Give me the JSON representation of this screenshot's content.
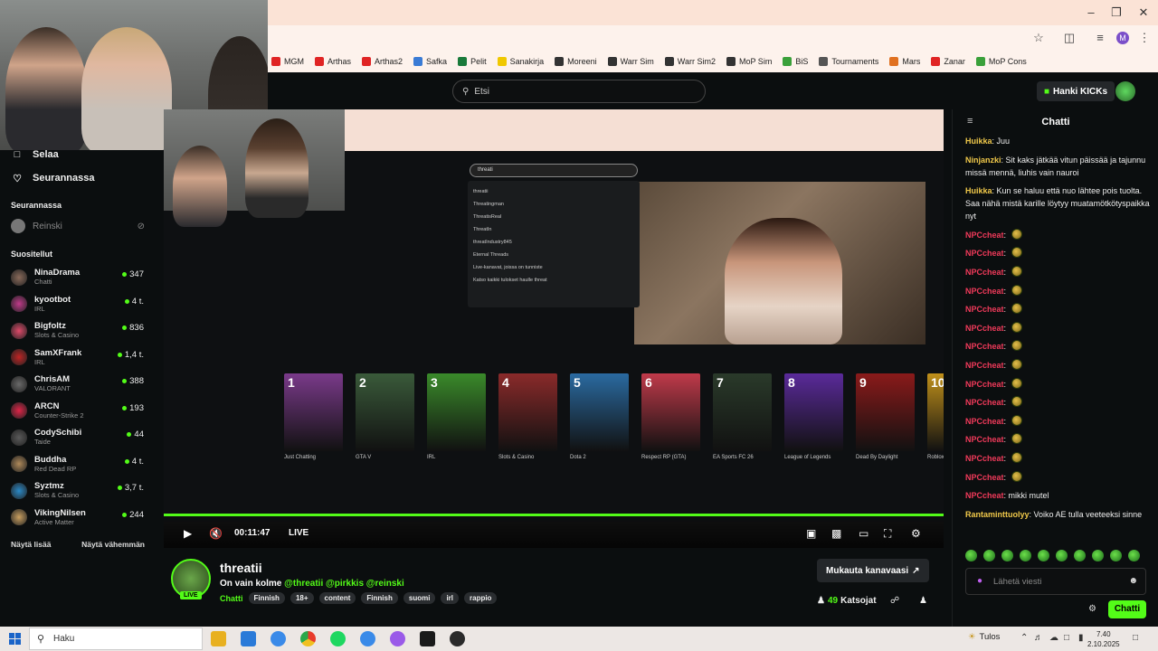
{
  "browser": {
    "bookmarks": [
      {
        "label": "MGM",
        "color": "#e02424"
      },
      {
        "label": "Arthas",
        "color": "#e02424"
      },
      {
        "label": "Arthas2",
        "color": "#e02424"
      },
      {
        "label": "Safka",
        "color": "#3a7bd5"
      },
      {
        "label": "Pelit",
        "color": "#1a7a3a"
      },
      {
        "label": "Sanakirja",
        "color": "#f0c800"
      },
      {
        "label": "Moreeni",
        "color": "#333333"
      },
      {
        "label": "Warr Sim",
        "color": "#333333"
      },
      {
        "label": "Warr Sim2",
        "color": "#333333"
      },
      {
        "label": "MoP Sim",
        "color": "#333333"
      },
      {
        "label": "BiS",
        "color": "#3aa03a"
      },
      {
        "label": "Tournaments",
        "color": "#555555"
      },
      {
        "label": "Mars",
        "color": "#e07020"
      },
      {
        "label": "Zanar",
        "color": "#e02424"
      },
      {
        "label": "MoP Cons",
        "color": "#3aa03a"
      }
    ],
    "profile_initial": "M"
  },
  "kick": {
    "search_placeholder": "Etsi",
    "get_kicks": "Hanki KICKs",
    "nav": [
      {
        "label": "Selaa",
        "icon": "browse-icon"
      },
      {
        "label": "Seurannassa",
        "icon": "heart-icon"
      }
    ],
    "following_header": "Seurannassa",
    "following": [
      {
        "name": "Reinski"
      }
    ],
    "recommended_header": "Suositellut",
    "recommended": [
      {
        "name": "NinaDrama",
        "category": "Chatti",
        "viewers": "347",
        "color": "#8a6a5a"
      },
      {
        "name": "kyootbot",
        "category": "IRL",
        "viewers": "4 t.",
        "color": "#c03a8a"
      },
      {
        "name": "Bigfoltz",
        "category": "Slots & Casino",
        "viewers": "836",
        "color": "#e04a6a"
      },
      {
        "name": "SamXFrank",
        "category": "IRL",
        "viewers": "1,4 t.",
        "color": "#c02424"
      },
      {
        "name": "ChrisAM",
        "category": "VALORANT",
        "viewers": "388",
        "color": "#6a6a6a"
      },
      {
        "name": "ARCN",
        "category": "Counter-Strike 2",
        "viewers": "193",
        "color": "#e02448"
      },
      {
        "name": "CodySchibi",
        "category": "Taide",
        "viewers": "44",
        "color": "#5a5a5a"
      },
      {
        "name": "Buddha",
        "category": "Red Dead RP",
        "viewers": "4 t.",
        "color": "#b08a5a"
      },
      {
        "name": "Syztmz",
        "category": "Slots & Casino",
        "viewers": "3,7 t.",
        "color": "#2a8ac8"
      },
      {
        "name": "VikingNilsen",
        "category": "Active Matter",
        "viewers": "244",
        "color": "#caa060"
      }
    ],
    "show_more": "Näytä lisää",
    "show_less": "Näytä vähemmän"
  },
  "player": {
    "time": "00:11:47",
    "live": "LIVE",
    "progress_fraction": 1.0,
    "inner_search_text": "threati",
    "inner_dropdown": [
      "threatii",
      "Threatingman",
      "ThreatisReal",
      "ThreatIn",
      "threatIndustry845",
      "Eternal Threads",
      "Live-kanavat, joissa on tunniste",
      "Katso kaikki tulokset haulle threat"
    ],
    "inner_categories": [
      {
        "num": "1",
        "name": "Just Chatting",
        "color": "#7a3a8a"
      },
      {
        "num": "2",
        "name": "GTA V",
        "color": "#3a5a3a"
      },
      {
        "num": "3",
        "name": "IRL",
        "color": "#3a8a2a"
      },
      {
        "num": "4",
        "name": "Slots & Casino",
        "color": "#8a2a2a"
      },
      {
        "num": "5",
        "name": "Dota 2",
        "color": "#2a6aa0"
      },
      {
        "num": "6",
        "name": "Respect RP (GTA)",
        "color": "#c03a4a"
      },
      {
        "num": "7",
        "name": "EA Sports FC 26",
        "color": "#2a3a2a"
      },
      {
        "num": "8",
        "name": "League of Legends",
        "color": "#5a2a9a"
      },
      {
        "num": "9",
        "name": "Dead By Daylight",
        "color": "#8a1a1a"
      },
      {
        "num": "10",
        "name": "Roblox",
        "color": "#c0901a"
      }
    ]
  },
  "stream": {
    "name": "threatii",
    "live": "LIVE",
    "title_prefix": "On vain kolme",
    "mentions": "@threatii @pirkkis @reinski",
    "category": "Chatti",
    "tags": [
      "Finnish",
      "18+",
      "content",
      "Finnish",
      "suomi",
      "irl",
      "rappio"
    ],
    "customize": "Mukauta kanavaasi",
    "viewers_count": "49",
    "viewers_label": "Katsojat"
  },
  "chat": {
    "title": "Chatti",
    "messages": [
      {
        "user": "Huikka",
        "color": "#f0c84a",
        "text": "Juu",
        "emote": false
      },
      {
        "user": "Ninjanzki",
        "color": "#f0c84a",
        "text": "Sit kaks jätkää vitun päissää ja tajunnu missä mennä, liuhis vain nauroi",
        "emote": false
      },
      {
        "user": "Huikka",
        "color": "#f0c84a",
        "text": "Kun se haluu että nuo lähtee pois tuolta. Saa nähä mistä karille löytyy muatamötkötyspaikka nyt",
        "emote": false
      },
      {
        "user": "NPCcheat",
        "color": "#f03a5a",
        "text": "",
        "emote": true
      },
      {
        "user": "NPCcheat",
        "color": "#f03a5a",
        "text": "",
        "emote": true
      },
      {
        "user": "NPCcheat",
        "color": "#f03a5a",
        "text": "",
        "emote": true
      },
      {
        "user": "NPCcheat",
        "color": "#f03a5a",
        "text": "",
        "emote": true
      },
      {
        "user": "NPCcheat",
        "color": "#f03a5a",
        "text": "",
        "emote": true
      },
      {
        "user": "NPCcheat",
        "color": "#f03a5a",
        "text": "",
        "emote": true
      },
      {
        "user": "NPCcheat",
        "color": "#f03a5a",
        "text": "",
        "emote": true
      },
      {
        "user": "NPCcheat",
        "color": "#f03a5a",
        "text": "",
        "emote": true
      },
      {
        "user": "NPCcheat",
        "color": "#f03a5a",
        "text": "",
        "emote": true
      },
      {
        "user": "NPCcheat",
        "color": "#f03a5a",
        "text": "",
        "emote": true
      },
      {
        "user": "NPCcheat",
        "color": "#f03a5a",
        "text": "",
        "emote": true
      },
      {
        "user": "NPCcheat",
        "color": "#f03a5a",
        "text": "",
        "emote": true
      },
      {
        "user": "NPCcheat",
        "color": "#f03a5a",
        "text": "",
        "emote": true
      },
      {
        "user": "NPCcheat",
        "color": "#f03a5a",
        "text": "",
        "emote": true
      },
      {
        "user": "NPCcheat",
        "color": "#f03a5a",
        "text": "mikki mutel",
        "emote": false
      },
      {
        "user": "Rantaminttuolyy",
        "color": "#f0c84a",
        "text": "Voiko AE tulla veeteeksi sinne",
        "emote": false
      }
    ],
    "input_placeholder": "Lähetä viesti",
    "send": "Chatti"
  },
  "taskbar": {
    "search_placeholder": "Haku",
    "weather": "Tulos",
    "time": "7.40",
    "date": "2.10.2025"
  },
  "colors": {
    "accent": "#53fc18",
    "background": "#0b0e0f"
  }
}
